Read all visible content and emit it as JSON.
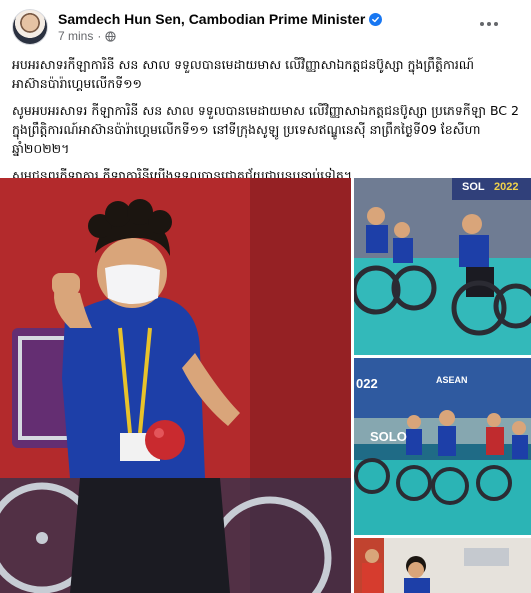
{
  "post": {
    "author": "Samdech Hun Sen, Cambodian Prime Minister",
    "time": "7 mins",
    "separator": "·",
    "paragraphs": [
      "អបអរសាទរកីឡាការិនី សន សាល ទទួលបានមេដាយមាស លើវិញ្ញាសាឯកត្តជនប៊ូស្សា ក្នុងព្រឹត្តិការណ៍អាស៊ានប៉ារ៉ាហ្គេមលើកទី១១",
      "សូមអបអរសាទរ កីឡាការិនី សន សាល ទទួលបានមេដាយមាស លើវិញ្ញាសាឯកត្តជនប៊ូស្សា ប្រភេទកីឡា BC 2  ក្នុងព្រឹត្តិការណ៍អាស៊ានប៉ារ៉ាហ្គេមលើកទី១១ នៅទីក្រុងសូឡូ ប្រទេសឥណ្ឌូនេស៊ី នាព្រឹកថ្ងៃទី09 ខែសីហា ឆ្នាំ២០២២។",
      "សូមជូនពរកីឡាការ កីឡាការិនីយើងទទួលបានជោគជ័យជាបន្តបន្ទាប់ទៀត។"
    ]
  },
  "photos": {
    "side_1_label": "SOL",
    "side_1_year": "2022",
    "side_2_label": "SOLO",
    "side_2_sign": "ASEAN",
    "side_2_year": "022"
  },
  "colors": {
    "verified": "#1877f2",
    "meta_text": "#65676b",
    "court_teal": "#2fb5b6"
  }
}
